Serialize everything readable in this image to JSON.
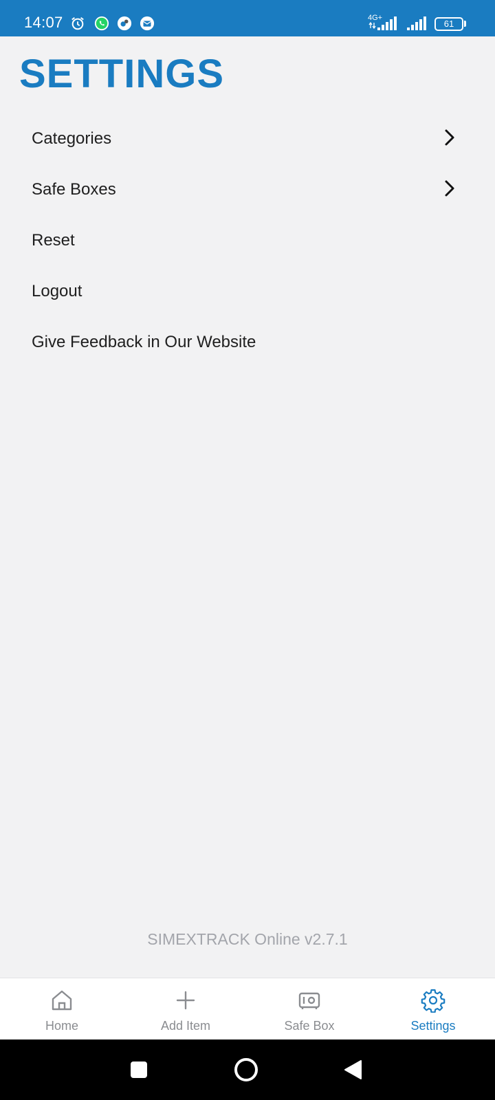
{
  "status_bar": {
    "time": "14:07",
    "network": "4G+",
    "battery": "61",
    "icons": [
      "alarm-icon",
      "whatsapp-icon",
      "app-notification-icon",
      "mail-notification-icon",
      "signal-icon",
      "signal-icon",
      "battery-icon"
    ]
  },
  "page": {
    "title": "SETTINGS"
  },
  "menu": {
    "items": [
      {
        "label": "Categories",
        "has_chevron": true
      },
      {
        "label": "Safe Boxes",
        "has_chevron": true
      },
      {
        "label": "Reset",
        "has_chevron": false
      },
      {
        "label": "Logout",
        "has_chevron": false
      },
      {
        "label": "Give Feedback in Our Website",
        "has_chevron": false
      }
    ]
  },
  "footer": {
    "version": "SIMEXTRACK Online v2.7.1"
  },
  "tabbar": {
    "tabs": [
      {
        "label": "Home",
        "icon": "home-icon",
        "active": false
      },
      {
        "label": "Add Item",
        "icon": "plus-icon",
        "active": false
      },
      {
        "label": "Safe Box",
        "icon": "safe-icon",
        "active": false
      },
      {
        "label": "Settings",
        "icon": "gear-icon",
        "active": true
      }
    ]
  },
  "navigation_bar": {
    "buttons": [
      "recents-icon",
      "home-icon",
      "back-icon"
    ]
  },
  "colors": {
    "accent": "#1a7cc1",
    "background": "#f2f2f3",
    "inactive": "#8a8c90"
  }
}
